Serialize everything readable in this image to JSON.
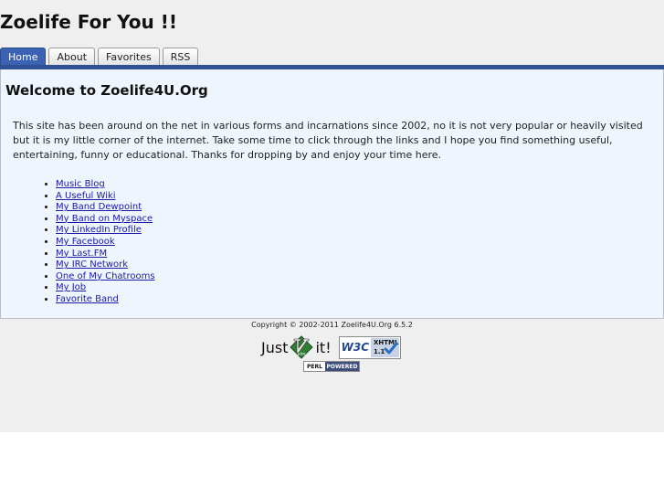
{
  "site": {
    "title": "Zoelife For You !!"
  },
  "nav": {
    "tabs": [
      {
        "label": "Home",
        "active": true
      },
      {
        "label": "About",
        "active": false
      },
      {
        "label": "Favorites",
        "active": false
      },
      {
        "label": "RSS",
        "active": false
      }
    ]
  },
  "content": {
    "heading": "Welcome to Zoelife4U.Org",
    "intro": "This site has been around on the net in various forms and incarnations since 2002, no it is not very popular or heavily visited but it is my little corner of the internet. Take some time to click through the links and I hope you find something useful, entertaining, funny or educational. Thanks for dropping by and enjoy your time here.",
    "links": [
      "Music Blog",
      "A Useful Wiki",
      "My Band Dewpoint",
      "My Band on Myspace",
      "My LinkedIn Profile",
      "My Facebook",
      "My Last.FM",
      "My IRC Network",
      "One of My Chatrooms",
      "My Job",
      "Favorite Band"
    ]
  },
  "footer": {
    "copyright": "Copyright © 2002-2011 Zoelife4U.Org 6.5.2",
    "vim_badge": {
      "before": "Just",
      "after": "it!"
    },
    "w3c_badge": {
      "mark": "W3C",
      "label": "XHTML",
      "version": "1.1"
    },
    "perl_badge": {
      "left": "PERL",
      "right": "POWERED"
    }
  },
  "colors": {
    "active_tab": "#3c62b3",
    "header_bar": "#2f5295",
    "content_bg": "#eef5fd",
    "link": "#1a1aa6",
    "page_bg": "#efefef"
  }
}
